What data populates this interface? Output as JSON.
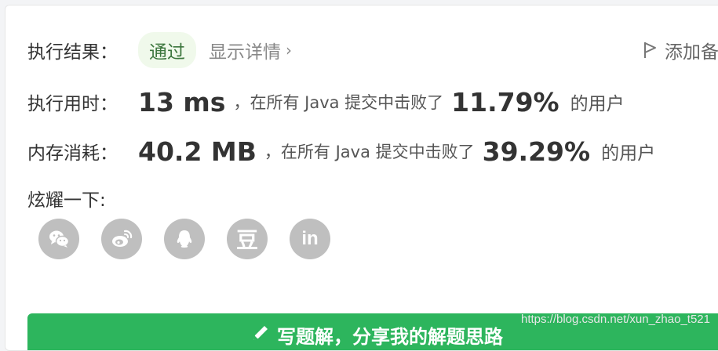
{
  "result": {
    "label": "执行结果：",
    "status": "通过",
    "detail_link": "显示详情",
    "detail_chevron": "›",
    "add_note": "添加备注"
  },
  "runtime": {
    "label": "执行用时：",
    "value": "13 ms",
    "sep": "，在所有 Java 提交中击败了",
    "percent": "11.79%",
    "suffix": "的用户"
  },
  "memory": {
    "label": "内存消耗：",
    "value": "40.2 MB",
    "sep": "，在所有 Java 提交中击败了",
    "percent": "39.29%",
    "suffix": "的用户"
  },
  "share": {
    "label": "炫耀一下:",
    "buttons": [
      {
        "name": "wechat",
        "icon": "wechat-icon"
      },
      {
        "name": "weibo",
        "icon": "weibo-icon"
      },
      {
        "name": "qq",
        "icon": "qq-icon"
      },
      {
        "name": "douban",
        "icon": "douban-icon",
        "glyph": "豆"
      },
      {
        "name": "linkedin",
        "icon": "linkedin-icon",
        "glyph": "in"
      }
    ]
  },
  "write_solution": {
    "label": "写题解，分享我的解题思路"
  },
  "watermark": "https://blog.csdn.net/xun_zhao_t521",
  "colors": {
    "accent_green": "#2db55d",
    "pass_bg": "#f0f9eb",
    "pass_text": "#3c763d",
    "icon_gray": "#bfbfbf"
  }
}
